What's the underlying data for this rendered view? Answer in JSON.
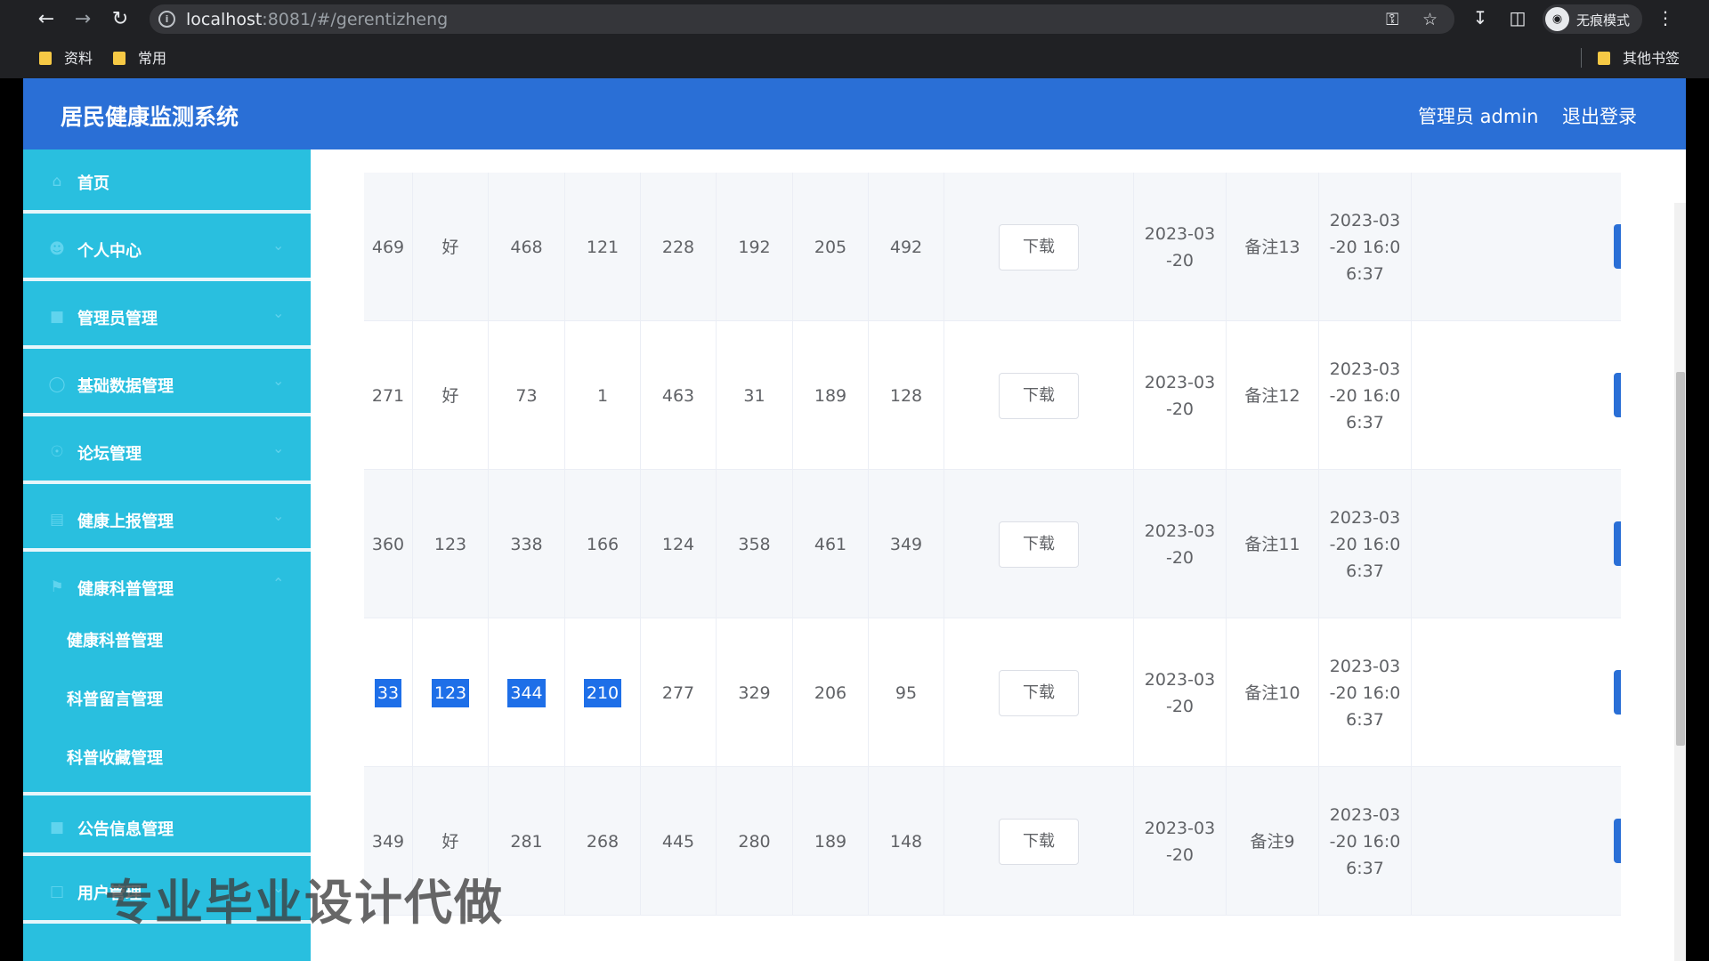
{
  "browser": {
    "url_host": "localhost",
    "url_rest": ":8081/#/gerentizheng",
    "incognito_label": "无痕模式",
    "bookmarks": [
      "资料",
      "常用"
    ],
    "other_bookmarks": "其他书签"
  },
  "header": {
    "title": "居民健康监测系统",
    "user": "管理员 admin",
    "logout": "退出登录"
  },
  "sidebar": {
    "items": [
      {
        "label": "首页",
        "icon": "home-icon"
      },
      {
        "label": "个人中心",
        "icon": "user-icon"
      },
      {
        "label": "管理员管理",
        "icon": "admin-icon"
      },
      {
        "label": "基础数据管理",
        "icon": "data-icon"
      },
      {
        "label": "论坛管理",
        "icon": "forum-icon"
      },
      {
        "label": "健康上报管理",
        "icon": "report-icon"
      },
      {
        "label": "健康科普管理",
        "icon": "flag-icon"
      }
    ],
    "sub_items": [
      "健康科普管理",
      "科普留言管理",
      "科普收藏管理"
    ],
    "lower_items": [
      {
        "label": "公告信息管理",
        "icon": "notice-icon"
      },
      {
        "label": "用户管理",
        "icon": "users-icon"
      }
    ]
  },
  "table": {
    "download_label": "下载",
    "rows": [
      {
        "c": [
          "469",
          "好",
          "468",
          "121",
          "228",
          "192",
          "205",
          "492"
        ],
        "date": "2023-03\n-20",
        "note": "备注13",
        "time": "2023-03\n-20 16:0\n6:37"
      },
      {
        "c": [
          "271",
          "好",
          "73",
          "1",
          "463",
          "31",
          "189",
          "128"
        ],
        "date": "2023-03\n-20",
        "note": "备注12",
        "time": "2023-03\n-20 16:0\n6:37"
      },
      {
        "c": [
          "360",
          "123",
          "338",
          "166",
          "124",
          "358",
          "461",
          "349"
        ],
        "date": "2023-03\n-20",
        "note": "备注11",
        "time": "2023-03\n-20 16:0\n6:37"
      },
      {
        "c": [
          "33",
          "123",
          "344",
          "210",
          "277",
          "329",
          "206",
          "95"
        ],
        "date": "2023-03\n-20",
        "note": "备注10",
        "time": "2023-03\n-20 16:0\n6:37"
      },
      {
        "c": [
          "349",
          "好",
          "281",
          "268",
          "445",
          "280",
          "189",
          "148"
        ],
        "date": "2023-03\n-20",
        "note": "备注9",
        "time": "2023-03\n-20 16:0\n6:37"
      }
    ]
  },
  "watermark": "专业毕业设计代做",
  "colors": {
    "header": "#2a6fd6",
    "sidebar": "#29bfdf",
    "highlight": "#1e6fe8"
  }
}
